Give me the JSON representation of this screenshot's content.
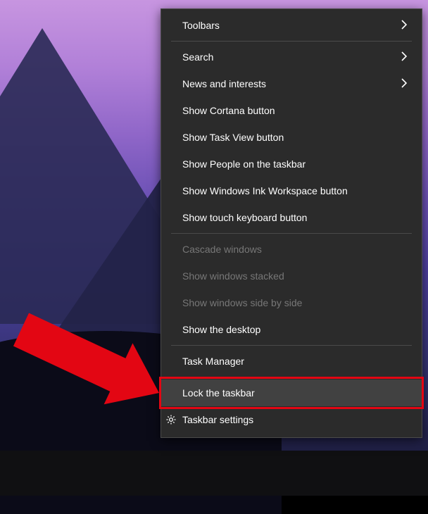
{
  "context_menu": {
    "items": [
      {
        "label": "Toolbars",
        "submenu": true,
        "enabled": true
      },
      {
        "separator": true
      },
      {
        "label": "Search",
        "submenu": true,
        "enabled": true
      },
      {
        "label": "News and interests",
        "submenu": true,
        "enabled": true
      },
      {
        "label": "Show Cortana button",
        "submenu": false,
        "enabled": true
      },
      {
        "label": "Show Task View button",
        "submenu": false,
        "enabled": true
      },
      {
        "label": "Show People on the taskbar",
        "submenu": false,
        "enabled": true
      },
      {
        "label": "Show Windows Ink Workspace button",
        "submenu": false,
        "enabled": true
      },
      {
        "label": "Show touch keyboard button",
        "submenu": false,
        "enabled": true
      },
      {
        "separator": true
      },
      {
        "label": "Cascade windows",
        "submenu": false,
        "enabled": false
      },
      {
        "label": "Show windows stacked",
        "submenu": false,
        "enabled": false
      },
      {
        "label": "Show windows side by side",
        "submenu": false,
        "enabled": false
      },
      {
        "label": "Show the desktop",
        "submenu": false,
        "enabled": true
      },
      {
        "separator": true
      },
      {
        "label": "Task Manager",
        "submenu": false,
        "enabled": true
      },
      {
        "separator": true
      },
      {
        "label": "Lock the taskbar",
        "submenu": false,
        "enabled": true,
        "hovered": true,
        "highlighted": true
      },
      {
        "label": "Taskbar settings",
        "submenu": false,
        "enabled": true,
        "icon": "gear-icon"
      }
    ]
  },
  "annotation": {
    "highlight_color": "#e30613",
    "arrow_color": "#e30613"
  }
}
